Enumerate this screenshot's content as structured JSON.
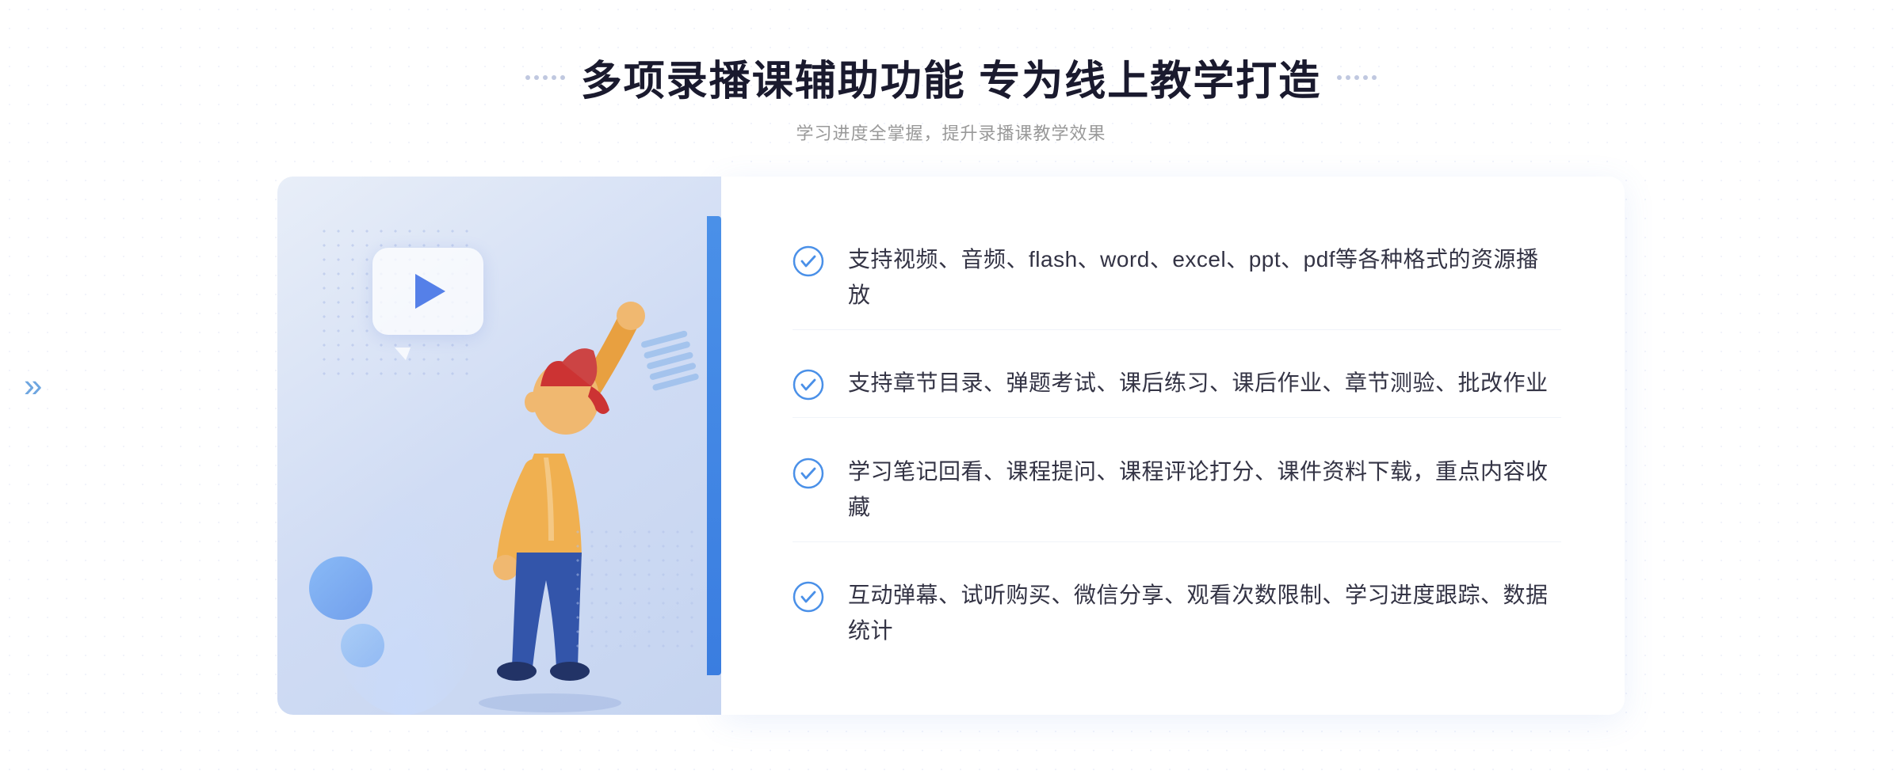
{
  "page": {
    "background_dots": true
  },
  "header": {
    "title": "多项录播课辅助功能 专为线上教学打造",
    "subtitle": "学习进度全掌握，提升录播课教学效果",
    "title_dots_left": "···",
    "title_dots_right": "···"
  },
  "left_chevron": "»",
  "features": [
    {
      "id": 1,
      "text": "支持视频、音频、flash、word、excel、ppt、pdf等各种格式的资源播放"
    },
    {
      "id": 2,
      "text": "支持章节目录、弹题考试、课后练习、课后作业、章节测验、批改作业"
    },
    {
      "id": 3,
      "text": "学习笔记回看、课程提问、课程评论打分、课件资料下载，重点内容收藏"
    },
    {
      "id": 4,
      "text": "互动弹幕、试听购买、微信分享、观看次数限制、学习进度跟踪、数据统计"
    }
  ],
  "icons": {
    "check": "check-circle-icon",
    "play": "play-icon",
    "chevron_left": "chevron-left-icon"
  },
  "colors": {
    "primary_blue": "#4a90e8",
    "light_blue": "#6aaaf7",
    "title_color": "#1a1a2e",
    "text_color": "#333344",
    "subtitle_color": "#999999",
    "check_color": "#4a90e8",
    "bg_panel": "#eef2fc"
  }
}
